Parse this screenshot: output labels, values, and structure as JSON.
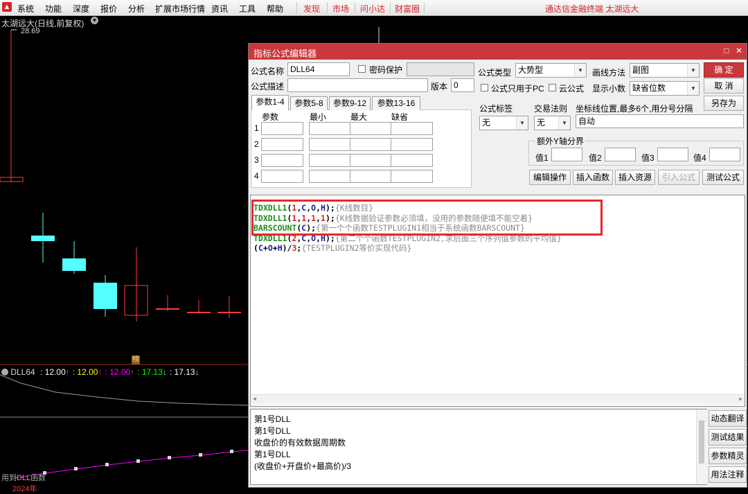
{
  "menu": {
    "items": [
      "系统",
      "功能",
      "深度",
      "报价",
      "分析",
      "扩展市场行情",
      "资讯",
      "工具",
      "帮助"
    ],
    "red_items": [
      "发现",
      "市场",
      "问小达",
      "财富圈"
    ],
    "app_title": "通达信金融终端  太湖远大"
  },
  "chart": {
    "stock_title": "太湖远大(日线,前复权)",
    "high_price": "28.69",
    "badge": "榜",
    "indicator": {
      "name": "DLL64",
      "values": [
        {
          "text": ": 12.00",
          "arrow": "↑",
          "color": "#ffffff"
        },
        {
          "text": ": 12.00",
          "arrow": "↑",
          "color": "#ffff00"
        },
        {
          "text": ": 12.00",
          "arrow": "↑",
          "color": "#ff00ff"
        },
        {
          "text": ": 17.13",
          "arrow": "↓",
          "color": "#00ff00"
        },
        {
          "text": ": 17.13",
          "arrow": "↓",
          "color": "#ffffff"
        }
      ]
    },
    "bottom_text": "用到DLL函数",
    "year_label": "2024年",
    "colors": {
      "down": "#54ffff",
      "up": "#ff3b3b",
      "purple": "#ff00ff"
    }
  },
  "dialog": {
    "title": "指标公式编辑器",
    "name_label": "公式名称",
    "name_value": "DLL64",
    "password_label": "密码保护",
    "desc_label": "公式描述",
    "version_label": "版本",
    "version_value": "0",
    "type_label": "公式类型",
    "type_value": "大势型",
    "draw_label": "画线方法",
    "draw_value": "副图",
    "pc_only_label": "公式只用于PC",
    "cloud_label": "云公式",
    "decimal_label": "显示小数",
    "decimal_value": "缺省位数",
    "ok_label": "确  定",
    "cancel_label": "取  消",
    "saveas_label": "另存为",
    "tabs": [
      "参数1-4",
      "参数5-8",
      "参数9-12",
      "参数13-16"
    ],
    "param_headers": [
      "参数",
      "最小",
      "最大",
      "缺省"
    ],
    "param_rows": [
      "1",
      "2",
      "3",
      "4"
    ],
    "tag_label": "公式标签",
    "tag_value": "无",
    "trade_label": "交易法则",
    "trade_value": "无",
    "coord_label": "坐标线位置,最多6个,用分号分隔",
    "coord_value": "自动",
    "yaxis_label": "额外Y轴分界",
    "yaxis_values": [
      "值1",
      "值2",
      "值3",
      "值4"
    ],
    "action_buttons": [
      "编辑操作",
      "插入函数",
      "插入资源",
      "引入公式",
      "测试公式"
    ],
    "code_lines": [
      [
        [
          "TDXDLL1",
          "fn"
        ],
        [
          "(",
          "op"
        ],
        [
          "1",
          "num"
        ],
        [
          ",",
          "op"
        ],
        [
          "C",
          "var"
        ],
        [
          ",",
          "op"
        ],
        [
          "O",
          "var"
        ],
        [
          ",",
          "op"
        ],
        [
          "H",
          "var"
        ],
        [
          ");",
          "op"
        ],
        [
          "{K线数目}",
          "cm"
        ]
      ],
      [
        [
          "TDXDLL1",
          "fn"
        ],
        [
          "(",
          "op"
        ],
        [
          "1",
          "num"
        ],
        [
          ",",
          "op"
        ],
        [
          "1",
          "num"
        ],
        [
          ",",
          "op"
        ],
        [
          "1",
          "num"
        ],
        [
          ",",
          "op"
        ],
        [
          "1",
          "num"
        ],
        [
          ");",
          "op"
        ],
        [
          "{K线数据验证参数必须填，没用的参数随便填不能空着}",
          "cm"
        ]
      ],
      [
        [
          "BARSCOUNT",
          "fn"
        ],
        [
          "(",
          "op"
        ],
        [
          "C",
          "var"
        ],
        [
          ");",
          "op"
        ],
        [
          "{第一个个函数TESTPLUGIN1相当于系统函数BARSCOUNT}",
          "cm"
        ]
      ],
      [
        [
          "TDXDLL1",
          "fn"
        ],
        [
          "(",
          "op"
        ],
        [
          "2",
          "num"
        ],
        [
          ",",
          "op"
        ],
        [
          "C",
          "var"
        ],
        [
          ",",
          "op"
        ],
        [
          "O",
          "var"
        ],
        [
          ",",
          "op"
        ],
        [
          "H",
          "var"
        ],
        [
          ");",
          "op"
        ],
        [
          "{第二个个函数TESTPLUGIN2,求后面三个序列值参数的平均值}",
          "cm"
        ]
      ],
      [
        [
          "(",
          "op"
        ],
        [
          "C",
          "var"
        ],
        [
          "+",
          "op"
        ],
        [
          "O",
          "var"
        ],
        [
          "+",
          "op"
        ],
        [
          "H",
          "var"
        ],
        [
          ")/",
          "op"
        ],
        [
          "3",
          "num"
        ],
        [
          ";",
          "op"
        ],
        [
          "{TESTPLUGIN2等价实现代码}",
          "cm"
        ]
      ]
    ],
    "output_lines": [
      "第1号DLL",
      "第1号DLL",
      "收盘价的有效数据周期数",
      "第1号DLL",
      "(收盘价+开盘价+最高价)/3"
    ],
    "side_buttons": [
      "动态翻译",
      "测试结果",
      "参数精灵",
      "用法注释"
    ]
  }
}
